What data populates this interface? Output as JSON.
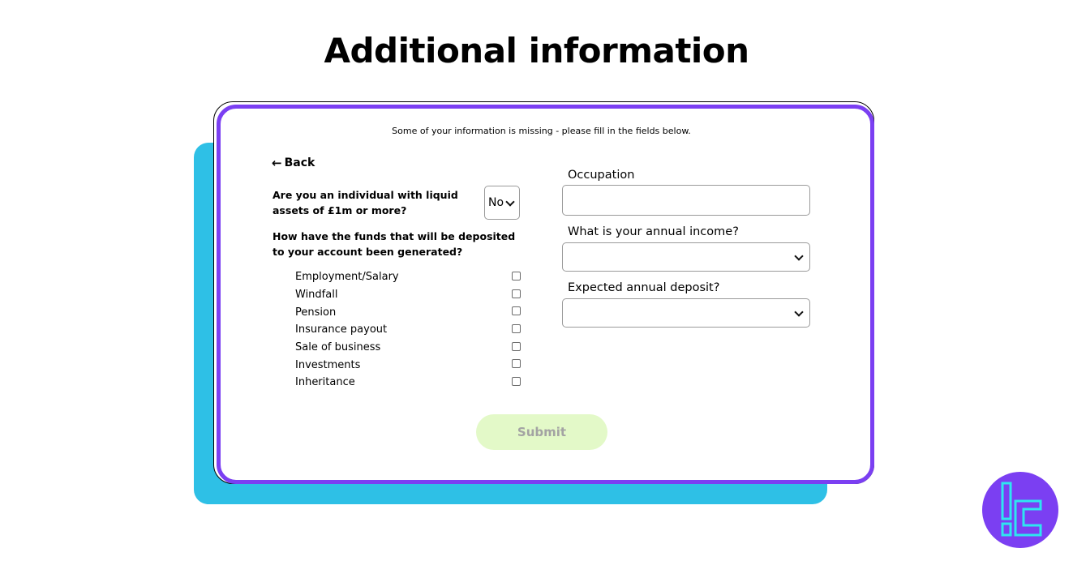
{
  "page": {
    "title": "Additional information"
  },
  "form": {
    "missing_note": "Some of your information is missing - please fill in the fields below.",
    "back_label": "Back",
    "liquid_assets_question": "Are you an individual with liquid assets of £1m or more?",
    "liquid_assets_value": "No",
    "funds_question": "How have the funds that will be deposited to your account been generated?",
    "funds_options": [
      {
        "label": "Employment/Salary",
        "checked": false
      },
      {
        "label": "Windfall",
        "checked": false
      },
      {
        "label": "Pension",
        "checked": false
      },
      {
        "label": "Insurance payout",
        "checked": false
      },
      {
        "label": "Sale of business",
        "checked": false
      },
      {
        "label": "Investments",
        "checked": false
      },
      {
        "label": "Inheritance",
        "checked": false
      }
    ],
    "occupation_label": "Occupation",
    "occupation_value": "",
    "income_label": "What is your annual income?",
    "income_value": "",
    "deposit_label": "Expected annual deposit?",
    "deposit_value": "",
    "submit_label": "Submit"
  },
  "colors": {
    "accent_purple": "#7b3ff2",
    "backdrop_cyan": "#2ec0e6",
    "submit_bg": "#e3f9c8",
    "submit_text": "#a3a3a3",
    "logo_purple": "#7b3ff2",
    "logo_mark": "#2ee6f0"
  },
  "icons": {
    "back": "arrow-left-icon",
    "dropdown": "chevron-down-icon",
    "logo": "brand-logo-icon"
  }
}
